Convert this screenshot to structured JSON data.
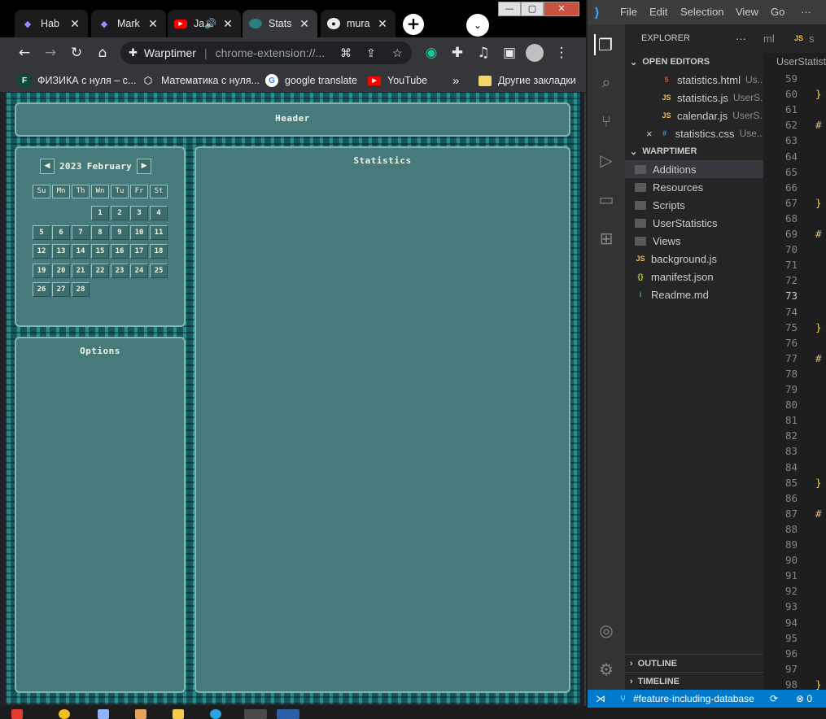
{
  "browser": {
    "tabs": [
      {
        "title": "Hab",
        "icon": "obsidian-icon"
      },
      {
        "title": "Mark",
        "icon": "obsidian-icon"
      },
      {
        "title": "Ja",
        "icon": "youtube-icon",
        "audio": true
      },
      {
        "title": "Stats",
        "icon": "warptimer-icon",
        "active": true
      },
      {
        "title": "mura",
        "icon": "github-icon"
      }
    ],
    "new_tab": "+",
    "omnibox": {
      "site": "Warptimer",
      "url": "chrome-extension://..."
    },
    "bookmarks": [
      {
        "label": "ФИЗИКА с нуля – с...",
        "icon_text": "F"
      },
      {
        "label": "Математика с нуля...",
        "icon_text": ""
      },
      {
        "label": "google translate",
        "icon_text": "G"
      },
      {
        "label": "YouTube",
        "icon_text": ""
      },
      {
        "label": "Другие закладки",
        "icon_text": ""
      }
    ],
    "bookmarks_more": "»"
  },
  "app": {
    "header_title": "Header",
    "statistics_title": "Statistics",
    "options_title": "Options",
    "calendar": {
      "year": "2023",
      "month": "February",
      "prev": "◀",
      "next": "▶",
      "weekdays": [
        "Su",
        "Mn",
        "Th",
        "Wn",
        "Tu",
        "Fr",
        "St"
      ],
      "first_weekday_index": 3,
      "days": 28
    }
  },
  "vscode": {
    "menu": [
      "File",
      "Edit",
      "Selection",
      "View",
      "Go",
      "···"
    ],
    "sidebar": {
      "explorer_label": "EXPLORER",
      "explorer_more": "···",
      "open_editors_label": "OPEN EDITORS",
      "open_editors": [
        {
          "name": "statistics.html",
          "desc": "Us...",
          "icon": "html-icon",
          "icon_text": "5",
          "icon_color": "#e44d26"
        },
        {
          "name": "statistics.js",
          "desc": "UserS...",
          "icon": "js-icon",
          "icon_text": "JS",
          "icon_color": "#f1bf40"
        },
        {
          "name": "calendar.js",
          "desc": "UserS...",
          "icon": "js-icon",
          "icon_text": "JS",
          "icon_color": "#f1bf40"
        },
        {
          "name": "statistics.css",
          "desc": "Use...",
          "icon": "css-icon",
          "icon_text": "#",
          "icon_color": "#519aba",
          "close": "×"
        }
      ],
      "project_label": "WARPTIMER",
      "folders": [
        "Additions",
        "Resources",
        "Scripts",
        "UserStatistics",
        "Views"
      ],
      "files": [
        {
          "name": "background.js",
          "icon_text": "JS",
          "icon_color": "#f1bf40"
        },
        {
          "name": "manifest.json",
          "icon_text": "{}",
          "icon_color": "#cbcb41"
        },
        {
          "name": "Readme.md",
          "icon_text": "i",
          "icon_color": "#519aba"
        }
      ],
      "outline_label": "OUTLINE",
      "timeline_label": "TIMELINE"
    },
    "editor": {
      "tabs": [
        "ml",
        "JS",
        "s"
      ],
      "breadcrumb": "UserStatistics",
      "line_start": 59,
      "line_end": 98,
      "current_line": 73,
      "brace_lines": [
        60,
        67,
        75,
        85,
        98
      ],
      "hash_lines": [
        62,
        69,
        77,
        87
      ]
    },
    "status": {
      "branch": "#feature-including-database",
      "sync": "⟳",
      "errors": "⊗ 0"
    }
  }
}
